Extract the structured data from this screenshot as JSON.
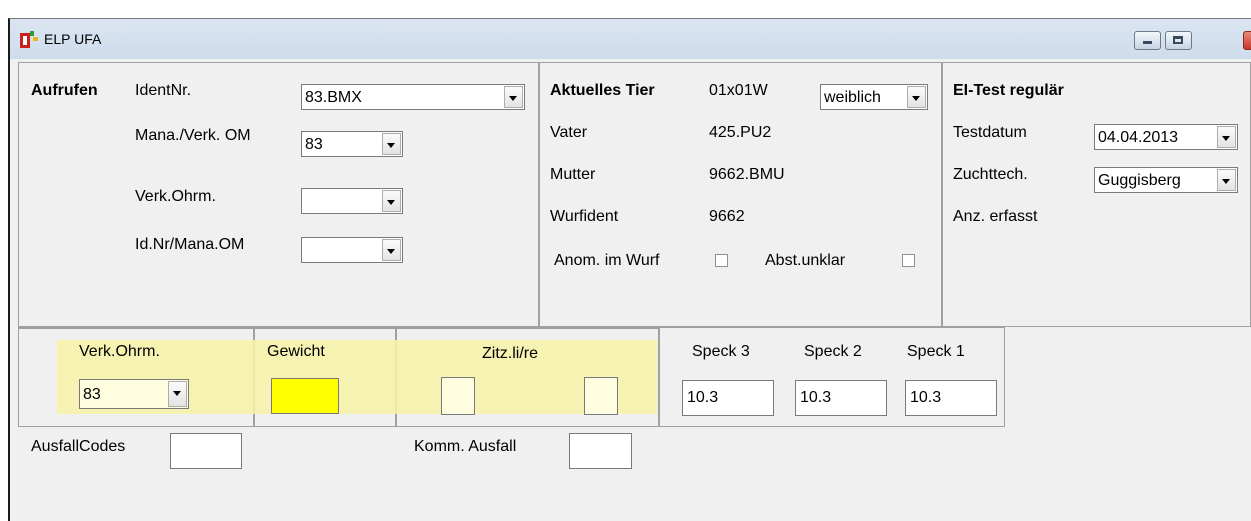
{
  "window": {
    "title": "ELP UFA"
  },
  "call_panel": {
    "heading": "Aufrufen",
    "identnr_label": "IdentNr.",
    "identnr_value": "83.BMX",
    "mana_label": "Mana./Verk. OM",
    "mana_value": "83",
    "verk_label": "Verk.Ohrm.",
    "verk_value": "",
    "idnr_label": "Id.Nr/Mana.OM",
    "idnr_value": ""
  },
  "animal_panel": {
    "heading": "Aktuelles Tier",
    "tier_id": "01x01W",
    "sex_value": "weiblich",
    "vater_label": "Vater",
    "vater_value": "425.PU2",
    "mutter_label": "Mutter",
    "mutter_value": "9662.BMU",
    "wurf_label": "Wurfident",
    "wurf_value": "9662",
    "anom_label": "Anom. im Wurf",
    "abst_label": "Abst.unklar"
  },
  "test_panel": {
    "heading": "EI-Test regulär",
    "testdatum_label": "Testdatum",
    "testdatum_value": "04.04.2013",
    "zucht_label": "Zuchttech.",
    "zucht_value": "Guggisberg",
    "anz_label": "Anz. erfasst"
  },
  "measure": {
    "verk_label": "Verk.Ohrm.",
    "verk_value": "83",
    "gewicht_label": "Gewicht",
    "zitz_label": "Zitz.li/re",
    "speck3_label": "Speck 3",
    "speck3_value": "10.3",
    "speck2_label": "Speck 2",
    "speck2_value": "10.3",
    "speck1_label": "Speck 1",
    "speck1_value": "10.3"
  },
  "bottom": {
    "ausfall_label": "AusfallCodes",
    "komm_label": "Komm. Ausfall"
  },
  "colors": {
    "highlight": "#f6f3a8",
    "gewicht_field": "#ffff00"
  }
}
